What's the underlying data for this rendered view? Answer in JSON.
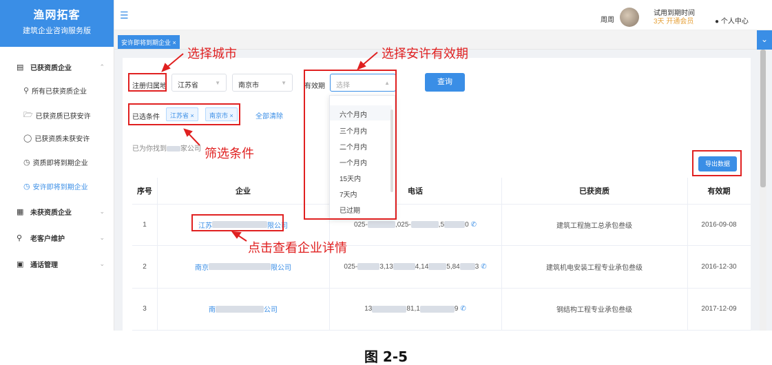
{
  "brand": {
    "title": "渔网拓客",
    "subtitle": "建筑企业咨询服务版"
  },
  "sidebar": {
    "groups": [
      {
        "label": "已获资质企业",
        "icon": "document-icon",
        "expanded": true
      },
      {
        "label": "未获资质企业",
        "icon": "building-icon",
        "expanded": false
      },
      {
        "label": "老客户维护",
        "icon": "user-icon",
        "expanded": false
      },
      {
        "label": "通话管理",
        "icon": "message-icon",
        "expanded": false
      }
    ],
    "subitems": [
      {
        "label": "所有已获资质企业",
        "icon": "search-icon"
      },
      {
        "label": "已获资质已获安许",
        "icon": "folder-icon"
      },
      {
        "label": "已获资质未获安许",
        "icon": "shield-icon"
      },
      {
        "label": "资质即将到期企业",
        "icon": "clock-icon"
      },
      {
        "label": "安许即将到期企业",
        "icon": "clock-icon",
        "active": true
      }
    ]
  },
  "header": {
    "username": "周周",
    "trial_label": "试用到期时间",
    "trial_days": "3天",
    "trial_link": "开通会员",
    "personal_center": "个人中心"
  },
  "tabs": [
    {
      "label": "安许即将到期企业"
    }
  ],
  "filters": {
    "region_label": "注册归属地",
    "province": "江苏省",
    "city": "南京市",
    "validity_label": "有效期",
    "validity_placeholder": "选择",
    "search_button": "查询",
    "selected_label": "已选条件",
    "selected_tags": [
      "江苏省",
      "南京市"
    ],
    "clear_all": "全部清除",
    "result_prefix": "已为你找到",
    "result_suffix": "家公司"
  },
  "dropdown_options": [
    "六个月内",
    "三个月内",
    "二个月内",
    "一个月内",
    "15天内",
    "7天内",
    "已过期"
  ],
  "export_button": "导出数据",
  "table": {
    "headers": [
      "序号",
      "企业",
      "电话",
      "已获资质",
      "有效期"
    ],
    "rows": [
      {
        "index": "1",
        "company_start": "江苏",
        "company_end": "限公司",
        "phone_parts": [
          "025-",
          ",025-",
          ",5",
          "0"
        ],
        "qualification": "建筑工程施工总承包叁级",
        "validity": "2016-09-08"
      },
      {
        "index": "2",
        "company_start": "南京",
        "company_end": "限公司",
        "phone_parts": [
          "025-",
          "3,13",
          "4,14",
          "5,84",
          "3"
        ],
        "qualification": "建筑机电安装工程专业承包叁级",
        "validity": "2016-12-30"
      },
      {
        "index": "3",
        "company_start": "南",
        "company_end": "公司",
        "phone_parts": [
          "13",
          "81,1",
          "9"
        ],
        "qualification": "钢结构工程专业承包叁级",
        "validity": "2017-12-09"
      }
    ]
  },
  "annotations": {
    "select_city": "选择城市",
    "select_validity": "选择安许有效期",
    "filter_conditions": "筛选条件",
    "click_detail": "点击查看企业详情"
  },
  "caption": "图 2-5",
  "colors": {
    "primary": "#3a8ee6",
    "annotation": "#e02020",
    "trial": "#e6a23c"
  }
}
